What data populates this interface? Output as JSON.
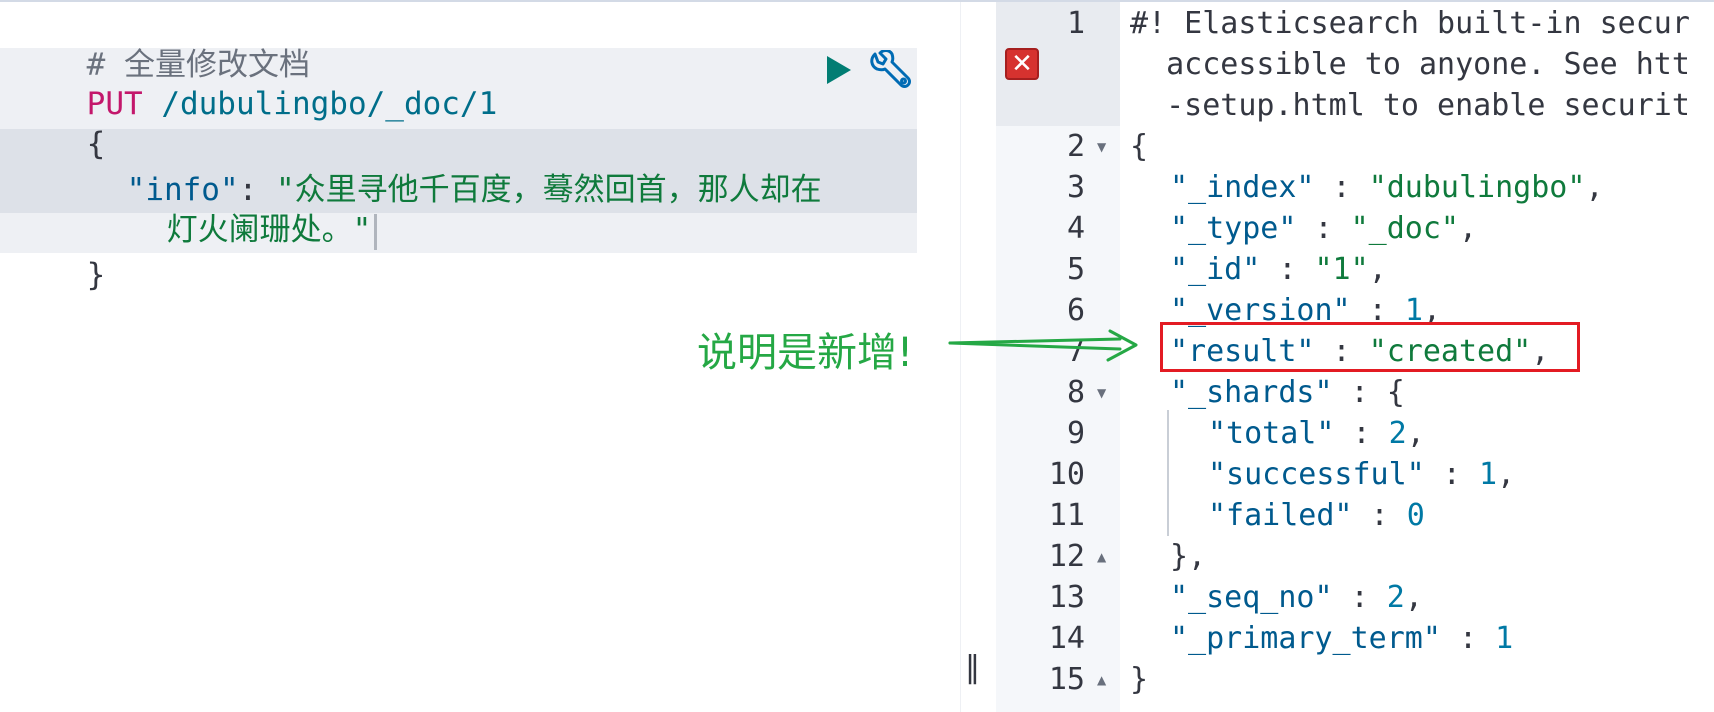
{
  "request": {
    "comment": "# 全量修改文档",
    "method": "PUT",
    "url": " /dubulingbo/_doc/1",
    "open_brace": "{",
    "info_key": "\"info\"",
    "colon": ": ",
    "info_value_line1": "\"众里寻他千百度，蓦然回首，那人却在",
    "info_value_line2": "灯火阑珊处。\"",
    "close_brace": "}"
  },
  "response": {
    "lines": [
      {
        "no": "1",
        "text": "#! Elasticsearch built-in secur"
      },
      {
        "no": "",
        "text": "  accessible to anyone. See htt"
      },
      {
        "no": "",
        "text": "  -setup.html to enable securit"
      },
      {
        "no": "2",
        "text": "{"
      },
      {
        "no": "3",
        "key": "\"_index\"",
        "sep": " : ",
        "value": "\"dubulingbo\"",
        "tail": ","
      },
      {
        "no": "4",
        "key": "\"_type\"",
        "sep": " : ",
        "value": "\"_doc\"",
        "tail": ","
      },
      {
        "no": "5",
        "key": "\"_id\"",
        "sep": " : ",
        "value": "\"1\"",
        "tail": ","
      },
      {
        "no": "6",
        "key": "\"_version\"",
        "sep": " : ",
        "value": "1",
        "tail": ","
      },
      {
        "no": "7",
        "key": "\"result\"",
        "sep": " : ",
        "value": "\"created\"",
        "tail": ","
      },
      {
        "no": "8",
        "key": "\"_shards\"",
        "sep": " : ",
        "value": "{",
        "tail": ""
      },
      {
        "no": "9",
        "key": "\"total\"",
        "sep": " : ",
        "value": "2",
        "tail": ","
      },
      {
        "no": "10",
        "key": "\"successful\"",
        "sep": " : ",
        "value": "1",
        "tail": ","
      },
      {
        "no": "11",
        "key": "\"failed\"",
        "sep": " : ",
        "value": "0",
        "tail": ""
      },
      {
        "no": "12",
        "text": "},"
      },
      {
        "no": "13",
        "key": "\"_seq_no\"",
        "sep": " : ",
        "value": "2",
        "tail": ","
      },
      {
        "no": "14",
        "key": "\"_primary_term\"",
        "sep": " : ",
        "value": "1",
        "tail": ""
      },
      {
        "no": "15",
        "text": "}"
      }
    ]
  },
  "icons": {
    "run": "play-icon",
    "settings": "wrench-icon",
    "error": "error-icon",
    "divider": "divider-handle-icon"
  },
  "error_symbol": "✕",
  "divider_glyph": "‖",
  "annotation": {
    "text": "说明是新增!"
  },
  "colors": {
    "run_button": "#017d73",
    "wrench_button": "#006bb4",
    "annotation": "#25a845",
    "highlight": "#e31b23"
  }
}
